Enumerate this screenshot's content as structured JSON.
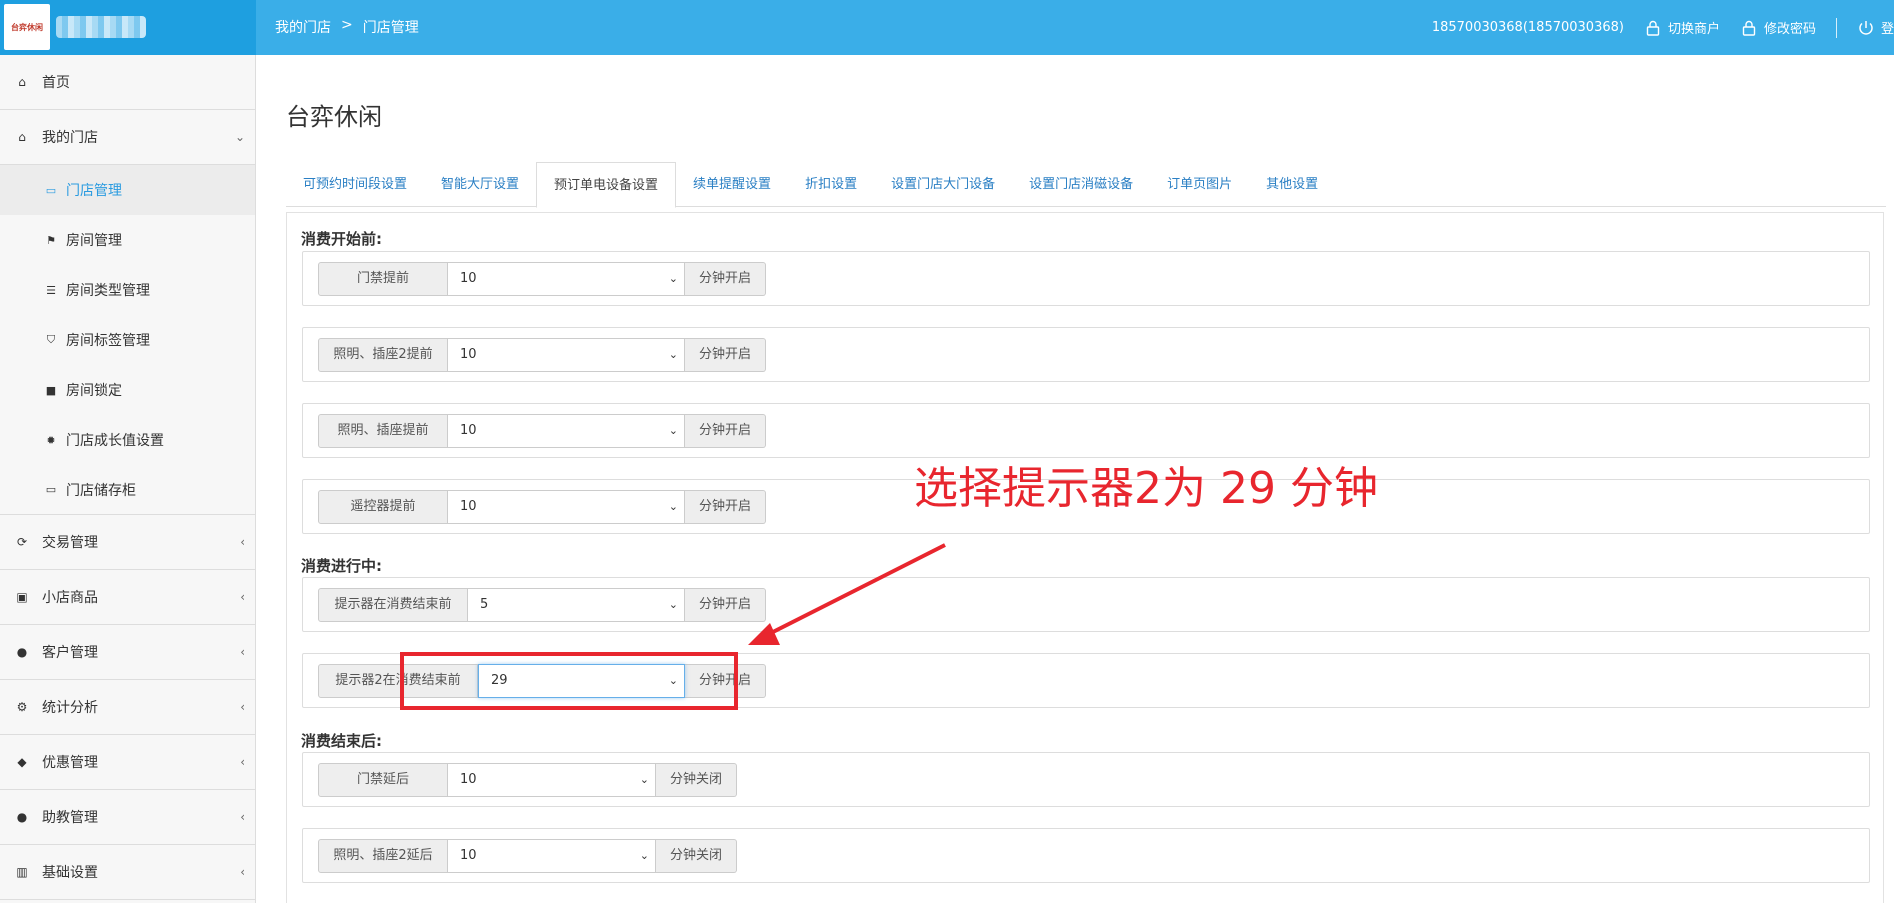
{
  "header": {
    "logo_text": "台弈休闲",
    "breadcrumb": [
      "我的门店",
      ">",
      "门店管理"
    ],
    "account": "18570030368(18570030368)",
    "switch_merchant": "切换商户",
    "change_password": "修改密码",
    "logout": "登"
  },
  "sidebar": {
    "home": "首页",
    "my_store": "我的门店",
    "sub_items": [
      "门店管理",
      "房间管理",
      "房间类型管理",
      "房间标签管理",
      "房间锁定",
      "门店成长值设置",
      "门店储存柜"
    ],
    "groups": [
      "交易管理",
      "小店商品",
      "客户管理",
      "统计分析",
      "优惠管理",
      "助教管理",
      "基础设置"
    ]
  },
  "main": {
    "store_name": "台弈休闲",
    "tabs": [
      "可预约时间段设置",
      "智能大厅设置",
      "预订单电设备设置",
      "续单提醒设置",
      "折扣设置",
      "设置门店大门设备",
      "设置门店消磁设备",
      "订单页图片",
      "其他设置"
    ],
    "sections": {
      "before": "消费开始前:",
      "during": "消费进行中:",
      "after": "消费结束后:"
    },
    "rows": [
      {
        "label": "门禁提前",
        "value": "10",
        "suffix": "分钟开启"
      },
      {
        "label": "照明、插座2提前",
        "value": "10",
        "suffix": "分钟开启"
      },
      {
        "label": "照明、插座提前",
        "value": "10",
        "suffix": "分钟开启"
      },
      {
        "label": "遥控器提前",
        "value": "10",
        "suffix": "分钟开启"
      },
      {
        "label": "提示器在消费结束前",
        "value": "5",
        "suffix": "分钟开启"
      },
      {
        "label": "提示器2在消费结束前",
        "value": "29",
        "suffix": "分钟开启"
      },
      {
        "label": "门禁延后",
        "value": "10",
        "suffix": "分钟关闭"
      },
      {
        "label": "照明、插座2延后",
        "value": "10",
        "suffix": "分钟关闭"
      }
    ]
  },
  "annotation": {
    "text": "选择提示器2为 29 分钟",
    "color": "#e8262e"
  },
  "colors": {
    "topbar": "#3aaee8",
    "active_link": "#2a9be0"
  }
}
